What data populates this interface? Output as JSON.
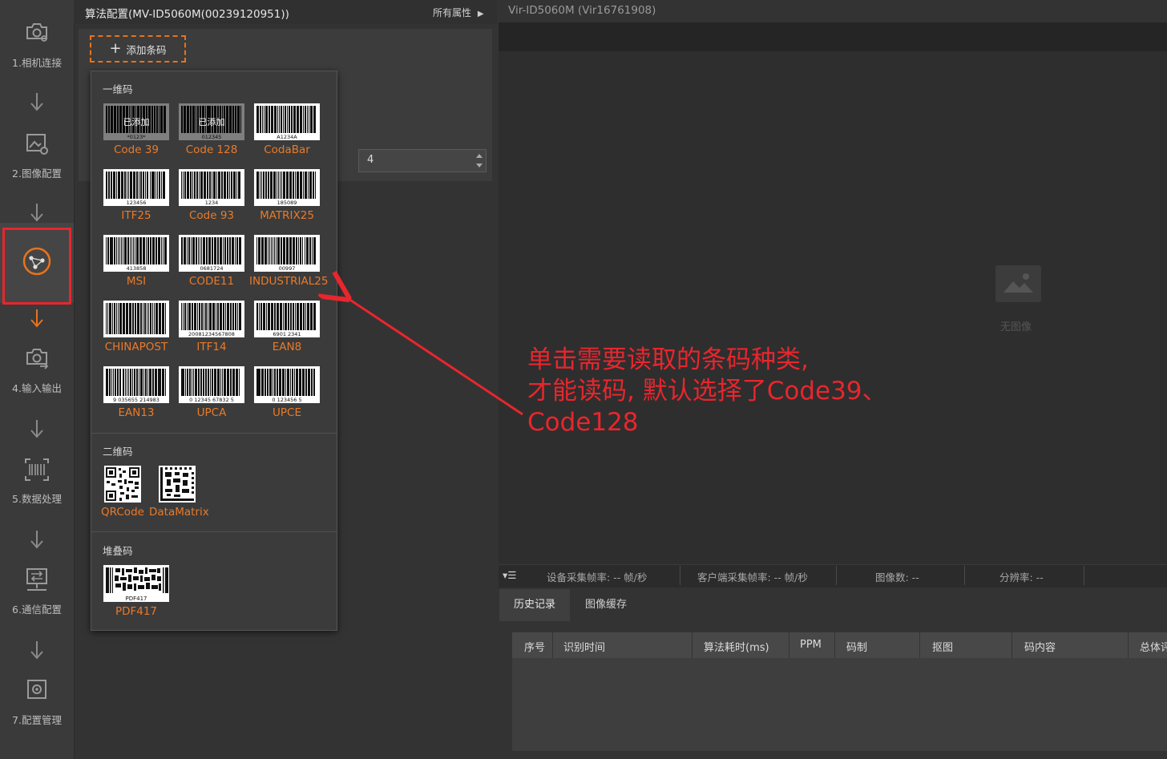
{
  "sidebar": {
    "steps": [
      {
        "label": "1.相机连接",
        "icon": "camera-link-icon"
      },
      {
        "label": "2.图像配置",
        "icon": "image-settings-icon"
      },
      {
        "label": "",
        "icon": "algorithm-nodes-icon",
        "active": true
      },
      {
        "label": "4.输入输出",
        "icon": "io-camera-icon"
      },
      {
        "label": "5.数据处理",
        "icon": "barcode-scan-icon"
      },
      {
        "label": "6.通信配置",
        "icon": "network-icon"
      },
      {
        "label": "7.配置管理",
        "icon": "config-gear-icon"
      }
    ],
    "highlight_color": "#e8262d"
  },
  "panel": {
    "title": "算法配置(MV-ID5060M(00239120951))",
    "all_props": "所有属性",
    "add_barcode": "添加条码",
    "number_value": "4"
  },
  "popup": {
    "sections": {
      "one_d": "一维码",
      "two_d": "二维码",
      "stacked": "堆叠码"
    },
    "added_label": "已添加",
    "one_d_codes": [
      {
        "name": "Code 39",
        "digits": "*0123*",
        "added": true
      },
      {
        "name": "Code 128",
        "digits": "012345",
        "added": true
      },
      {
        "name": "CodaBar",
        "digits": "A1234A",
        "added": false
      },
      {
        "name": "ITF25",
        "digits": "123456",
        "added": false
      },
      {
        "name": "Code 93",
        "digits": "1234",
        "added": false
      },
      {
        "name": "MATRIX25",
        "digits": "185089",
        "added": false
      },
      {
        "name": "MSI",
        "digits": "413858",
        "added": false
      },
      {
        "name": "CODE11",
        "digits": "0681724",
        "added": false
      },
      {
        "name": "INDUSTRIAL25",
        "digits": "00997",
        "added": false
      },
      {
        "name": "CHINAPOST",
        "digits": "",
        "added": false
      },
      {
        "name": "ITF14",
        "digits": "20081234567808",
        "added": false
      },
      {
        "name": "EAN8",
        "digits": "6901 2341",
        "added": false
      },
      {
        "name": "EAN13",
        "digits": "9 035655 214983",
        "added": false
      },
      {
        "name": "UPCA",
        "digits": "0 12345 67832 5",
        "added": false
      },
      {
        "name": "UPCE",
        "digits": "0 123456 5",
        "added": false
      }
    ],
    "two_d_codes": [
      {
        "name": "QRCode"
      },
      {
        "name": "DataMatrix"
      }
    ],
    "stacked_codes": [
      {
        "name": "PDF417",
        "digits": "PDF417"
      }
    ],
    "name_color": "#ea7a2a"
  },
  "view": {
    "title": "Vir-ID5060M (Vir16761908)",
    "no_image": "无图像",
    "status": {
      "device_fps": "设备采集帧率: -- 帧/秒",
      "client_fps": "客户端采集帧率: -- 帧/秒",
      "image_count": "图像数: --",
      "resolution": "分辨率: --"
    },
    "tabs": {
      "history": "历史记录",
      "cache": "图像缓存"
    },
    "table_headers": [
      "序号",
      "识别时间",
      "算法耗时(ms)",
      "PPM",
      "码制",
      "抠图",
      "码内容",
      "总体评"
    ]
  },
  "annotation": {
    "lines": [
      "单击需要读取的条码种类,",
      "才能读码, 默认选择了Code39、",
      "Code128"
    ],
    "color": "#e8262d"
  }
}
